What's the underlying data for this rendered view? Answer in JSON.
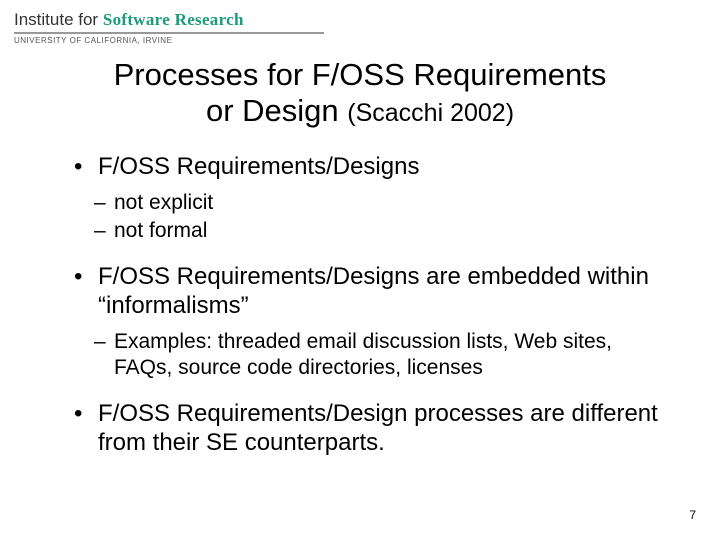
{
  "logo": {
    "prefix": "Institute for ",
    "emphasis": "Software Research",
    "subtitle": "UNIVERSITY OF CALIFORNIA, IRVINE"
  },
  "title": {
    "line1": "Processes for F/OSS Requirements",
    "line2_main": "or Design ",
    "line2_cite": "(Scacchi 2002)"
  },
  "bullets": {
    "b1": "F/OSS Requirements/Designs",
    "b1_subs": {
      "s1": "not explicit",
      "s2": "not formal"
    },
    "b2": "F/OSS Requirements/Designs are embedded within “informalisms”",
    "b2_subs": {
      "s1": "Examples: threaded email discussion lists, Web sites, FAQs, source code directories, licenses"
    },
    "b3": "F/OSS Requirements/Design processes are different from their SE counterparts."
  },
  "page_number": "7"
}
